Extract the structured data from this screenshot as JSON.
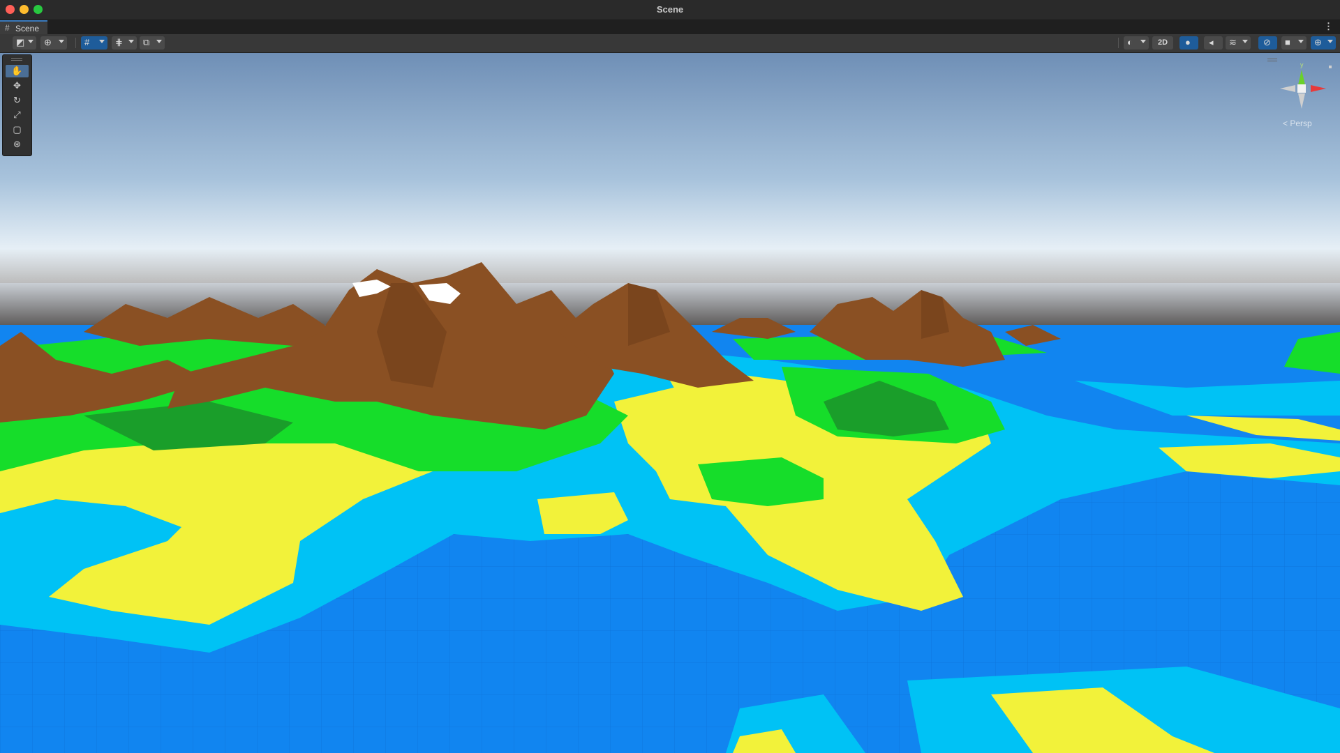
{
  "window": {
    "title": "Scene"
  },
  "tab": {
    "label": "Scene",
    "icon": "grid-icon",
    "menu_icon": "⋮"
  },
  "toolbar": {
    "left": [
      {
        "name": "draw-mode-button",
        "icon": "shaded-icon"
      },
      {
        "name": "global-local-button",
        "icon": "globe-icon"
      },
      {
        "name": "grid-snap-button",
        "icon": "grid-snap-icon"
      },
      {
        "name": "grid-visibility-button",
        "icon": "grid-icon"
      },
      {
        "name": "increment-snap-button",
        "icon": "snap-icon"
      }
    ],
    "right": [
      {
        "name": "shading-mode-button",
        "icon": "sphere-icon"
      },
      {
        "name": "2d-toggle",
        "label": "2D"
      },
      {
        "name": "lighting-toggle",
        "icon": "bulb-icon"
      },
      {
        "name": "audio-toggle",
        "icon": "speaker-icon"
      },
      {
        "name": "effects-button",
        "icon": "layers-icon"
      },
      {
        "name": "hidden-objects-toggle",
        "icon": "eye-slash-icon"
      },
      {
        "name": "camera-button",
        "icon": "camera-icon"
      },
      {
        "name": "gizmos-button",
        "icon": "gizmo-icon"
      }
    ]
  },
  "tools": [
    {
      "name": "hand-tool",
      "icon": "hand-icon",
      "active": true
    },
    {
      "name": "move-tool",
      "icon": "move-icon",
      "active": false
    },
    {
      "name": "rotate-tool",
      "icon": "rotate-icon",
      "active": false
    },
    {
      "name": "scale-tool",
      "icon": "scale-icon",
      "active": false
    },
    {
      "name": "rect-tool",
      "icon": "rect-icon",
      "active": false
    },
    {
      "name": "transform-tool",
      "icon": "transform-icon",
      "active": false
    }
  ],
  "gizmo": {
    "y_label": "y",
    "projection": "Persp"
  },
  "colors": {
    "accent": "#3a79bb",
    "deep_water": "#1185f0",
    "shallow_water": "#00c2f5",
    "sand": "#f2f23a",
    "grass": "#16dd2a",
    "dark_grass": "#1a9e2a",
    "mountain": "#8a5023",
    "snow": "#ffffff"
  }
}
